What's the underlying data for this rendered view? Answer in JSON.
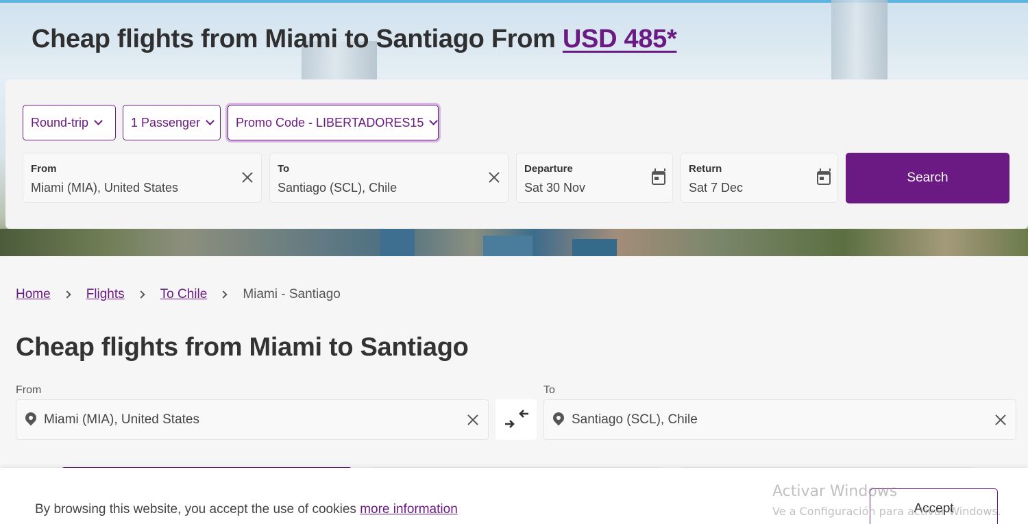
{
  "hero": {
    "title_prefix": "Cheap flights from Miami to Santiago From ",
    "price": "USD 485*"
  },
  "search": {
    "trip_type": "Round-trip",
    "passengers": "1 Passenger",
    "promo": "Promo Code - LIBERTADORES15",
    "from_label": "From",
    "from_value": "Miami (MIA), United States",
    "to_label": "To",
    "to_value": "Santiago (SCL), Chile",
    "departure_label": "Departure",
    "departure_value": "Sat 30 Nov",
    "return_label": "Return",
    "return_value": "Sat 7 Dec",
    "search_button": "Search"
  },
  "breadcrumb": {
    "items": [
      "Home",
      "Flights",
      "To Chile"
    ],
    "current": "Miami - Santiago"
  },
  "page_title": "Cheap flights from Miami to Santiago",
  "route": {
    "from_label": "From",
    "from_value": "Miami (MIA), United States",
    "to_label": "To",
    "to_value": "Santiago (SCL), Chile"
  },
  "cookie": {
    "message": "By browsing this website, you accept the use of cookies ",
    "link": "more information",
    "accept": "Accept"
  },
  "watermark": {
    "line1": "Activar Windows",
    "line2": "Ve a Configuración para activar Windows."
  },
  "colors": {
    "brand": "#6b1a83",
    "background": "#f6f6f6"
  }
}
